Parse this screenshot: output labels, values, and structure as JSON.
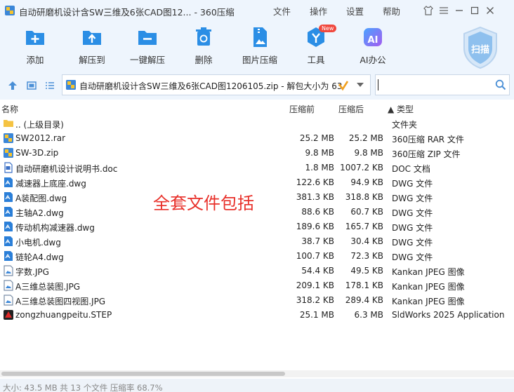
{
  "window": {
    "title": "自动研磨机设计含SW三维及6张CAD图12... - 360压缩",
    "menu": [
      "文件",
      "操作",
      "设置",
      "帮助"
    ]
  },
  "toolbar": {
    "items": [
      {
        "label": "添加",
        "icon": "add-icon"
      },
      {
        "label": "解压到",
        "icon": "extract-to-icon"
      },
      {
        "label": "一键解压",
        "icon": "one-click-extract-icon"
      },
      {
        "label": "删除",
        "icon": "trash-icon"
      },
      {
        "label": "图片压缩",
        "icon": "image-compress-icon"
      },
      {
        "label": "工具",
        "icon": "tools-icon",
        "badge": "New"
      },
      {
        "label": "AI办公",
        "icon": "ai-office-icon",
        "badge_text": "AI"
      }
    ],
    "scan_label": "扫描"
  },
  "address": {
    "path": "自动研磨机设计含SW三维及6张CAD图1206105.zip - 解包大小为 63"
  },
  "columns": {
    "name": "名称",
    "packed": "压缩前",
    "unpacked": "压缩后",
    "type": "▲ 类型"
  },
  "files": [
    {
      "name": ".. (上级目录)",
      "size": "",
      "packed": "",
      "type": "文件夹",
      "icon": "folder-up"
    },
    {
      "name": "SW2012.rar",
      "size": "25.2 MB",
      "packed": "25.2 MB",
      "type": "360压缩 RAR 文件",
      "icon": "archive"
    },
    {
      "name": "SW-3D.zip",
      "size": "9.8 MB",
      "packed": "9.8 MB",
      "type": "360压缩 ZIP 文件",
      "icon": "archive"
    },
    {
      "name": "自动研磨机设计说明书.doc",
      "size": "1.8 MB",
      "packed": "1007.2 KB",
      "type": "DOC 文档",
      "icon": "doc"
    },
    {
      "name": "减速器上底座.dwg",
      "size": "122.6 KB",
      "packed": "94.9 KB",
      "type": "DWG 文件",
      "icon": "dwg"
    },
    {
      "name": "A装配图.dwg",
      "size": "381.3 KB",
      "packed": "318.8 KB",
      "type": "DWG 文件",
      "icon": "dwg"
    },
    {
      "name": "主轴A2.dwg",
      "size": "88.6 KB",
      "packed": "60.7 KB",
      "type": "DWG 文件",
      "icon": "dwg"
    },
    {
      "name": "传动机构减速器.dwg",
      "size": "189.6 KB",
      "packed": "165.7 KB",
      "type": "DWG 文件",
      "icon": "dwg"
    },
    {
      "name": "小电机.dwg",
      "size": "38.7 KB",
      "packed": "30.4 KB",
      "type": "DWG 文件",
      "icon": "dwg"
    },
    {
      "name": "链轮A4.dwg",
      "size": "100.7 KB",
      "packed": "72.3 KB",
      "type": "DWG 文件",
      "icon": "dwg"
    },
    {
      "name": "字数.JPG",
      "size": "54.4 KB",
      "packed": "49.5 KB",
      "type": "Kankan JPEG 图像",
      "icon": "jpg"
    },
    {
      "name": "A三维总装图.JPG",
      "size": "209.1 KB",
      "packed": "178.1 KB",
      "type": "Kankan JPEG 图像",
      "icon": "jpg"
    },
    {
      "name": "A三维总装图四视图.JPG",
      "size": "318.2 KB",
      "packed": "289.4 KB",
      "type": "Kankan JPEG 图像",
      "icon": "jpg"
    },
    {
      "name": "zongzhuangpeitu.STEP",
      "size": "25.1 MB",
      "packed": "6.3 MB",
      "type": "SldWorks 2025 Application",
      "icon": "step"
    }
  ],
  "overlay_text": "全套文件包括",
  "status": "大小: 43.5 MB 共 13 个文件 压缩率 68.7%",
  "colors": {
    "accent": "#2b8ee5",
    "chrome": "#eef5fd",
    "overlay": "#e8302a"
  }
}
